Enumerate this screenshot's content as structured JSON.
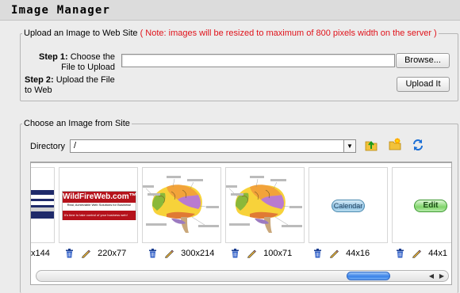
{
  "window": {
    "title": "Image Manager"
  },
  "upload": {
    "legend": "Upload an Image to Web Site",
    "note": "( Note: images will be resized to maximum of 800 pixels width on the server )",
    "step1_bold": "Step 1:",
    "step1_text": "Choose the File to Upload",
    "step2_bold": "Step 2:",
    "step2_text": "Upload the File to Web",
    "browse_label": "Browse...",
    "upload_label": "Upload It",
    "file_value": ""
  },
  "choose": {
    "legend": "Choose an Image from Site",
    "directory_label": "Directory",
    "directory_value": "/"
  },
  "gallery": {
    "images": [
      {
        "size": "x144",
        "kind": "form-screenshot"
      },
      {
        "size": "220x77",
        "kind": "banner",
        "banner_title": "WildFireWeb.com™",
        "banner_tagline": "Real, Achievable Web Solutions for Business!",
        "banner_footer": "It's time to take control of your business web!"
      },
      {
        "size": "300x214",
        "kind": "brain"
      },
      {
        "size": "100x71",
        "kind": "brain"
      },
      {
        "size": "44x16",
        "kind": "button",
        "button_text": "Calendar"
      },
      {
        "size": "44x1",
        "kind": "button",
        "button_text": "Edit"
      }
    ]
  },
  "icons": {
    "up_folder": "folder-up-icon",
    "new_folder": "new-folder-icon",
    "refresh": "refresh-icon",
    "delete": "trash-icon",
    "edit": "pencil-icon"
  }
}
